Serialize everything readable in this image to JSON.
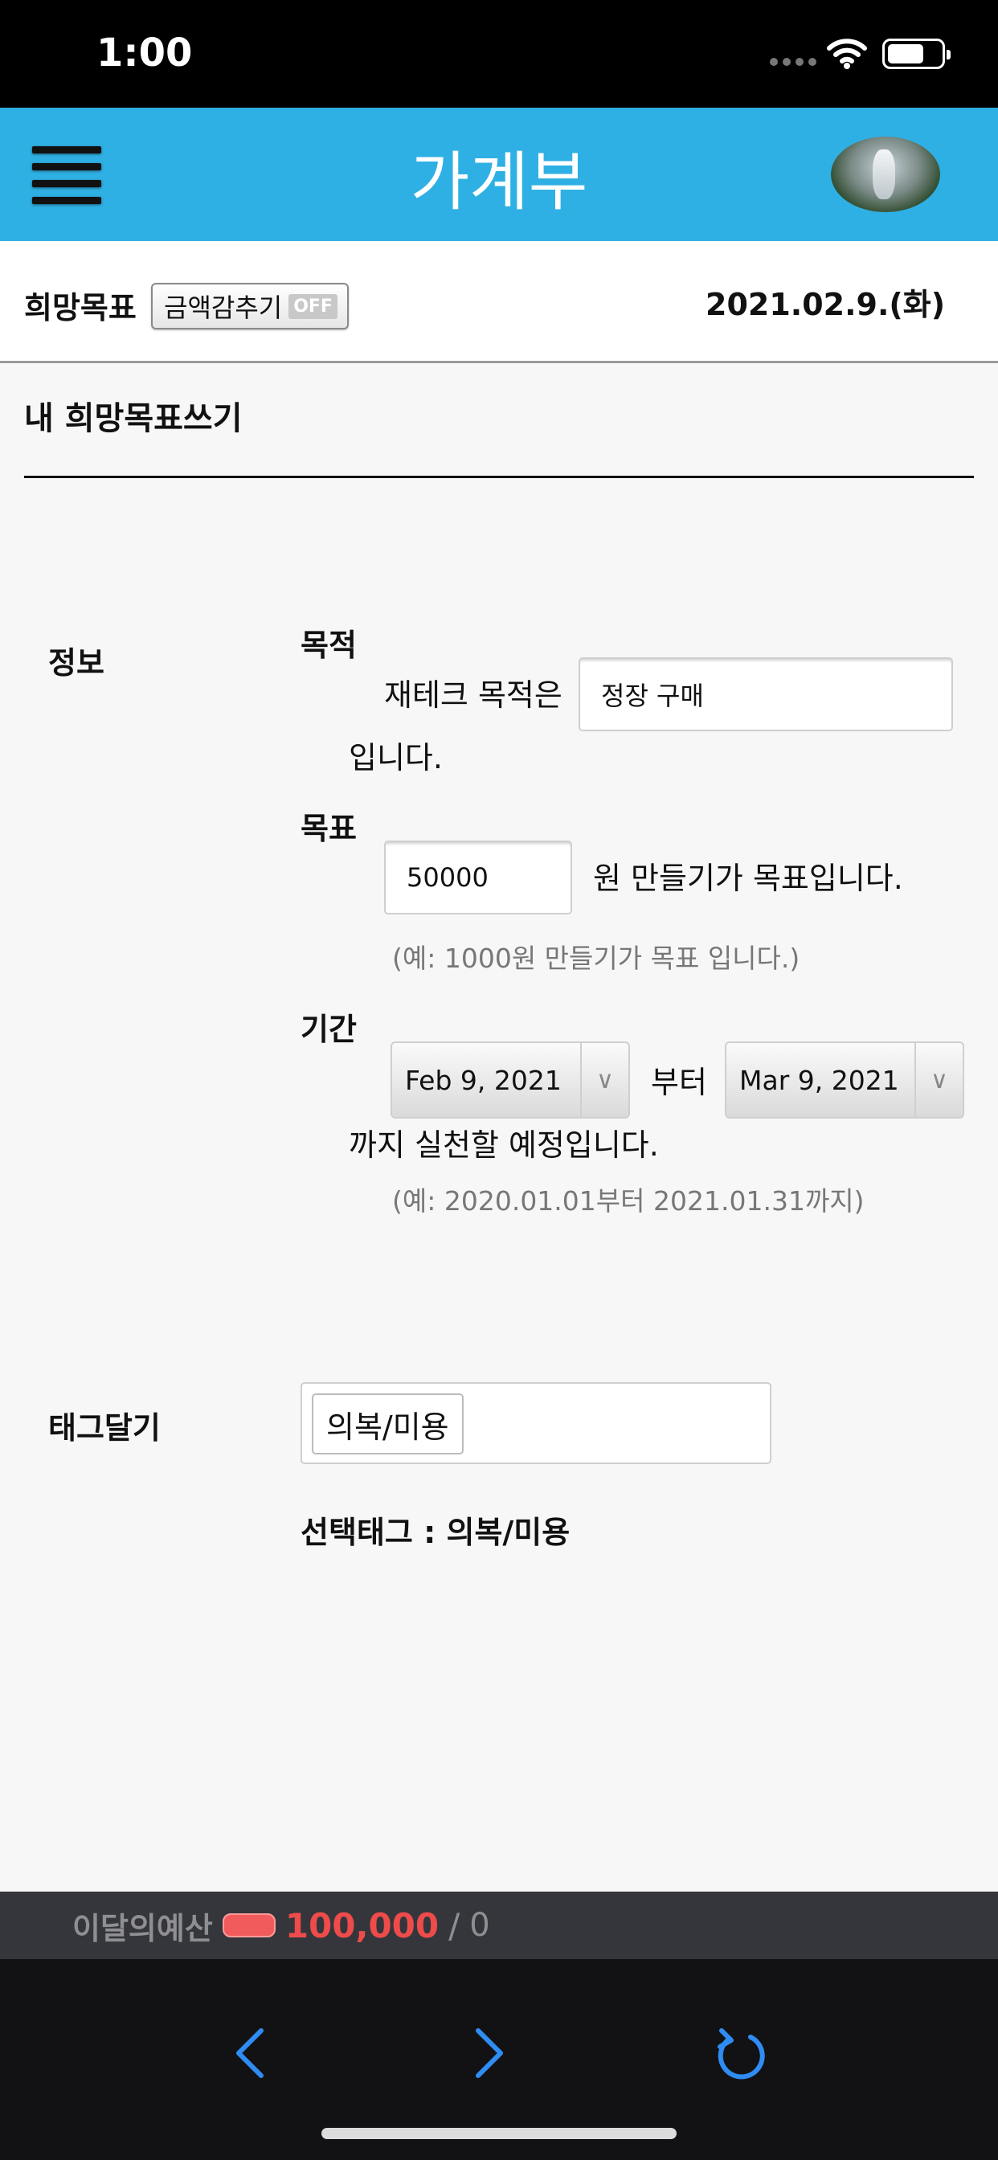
{
  "status_bar": {
    "time": "1:00"
  },
  "header": {
    "title": "가계부"
  },
  "top_bar": {
    "page_label": "희망목표",
    "hide_amount_label": "금액감추기",
    "hide_amount_state": "OFF",
    "date": "2021.02.9.(화)"
  },
  "section": {
    "title": "내 희망목표쓰기"
  },
  "info": {
    "label": "정보",
    "purpose": {
      "label": "목적",
      "prefix": "재테크 목적은",
      "value": "정장 구매",
      "suffix": "입니다."
    },
    "goal": {
      "label": "목표",
      "value": "50000",
      "suffix": "원 만들기가 목표입니다.",
      "hint": "(예: 1000원 만들기가 목표 입니다.)"
    },
    "period": {
      "label": "기간",
      "start": "Feb 9, 2021",
      "from_text": "부터",
      "end": "Mar 9, 2021",
      "suffix": "까지 실천할 예정입니다.",
      "hint": "(예: 2020.01.01부터 2021.01.31까지)"
    }
  },
  "tags": {
    "label": "태그달기",
    "chip": "의복/미용",
    "selected_text": "선택태그 : 의복/미용"
  },
  "budget": {
    "label": "이달의예산",
    "amount": "100,000",
    "separator": "/",
    "used": "0"
  },
  "colors": {
    "header_bg": "#2fb0e4",
    "budget_amount": "#ee4b4b",
    "nav_icon": "#2f8cf2"
  },
  "icons": {
    "menu": "menu-icon",
    "back": "chevron-left-icon",
    "forward": "chevron-right-icon",
    "reload": "reload-icon"
  }
}
